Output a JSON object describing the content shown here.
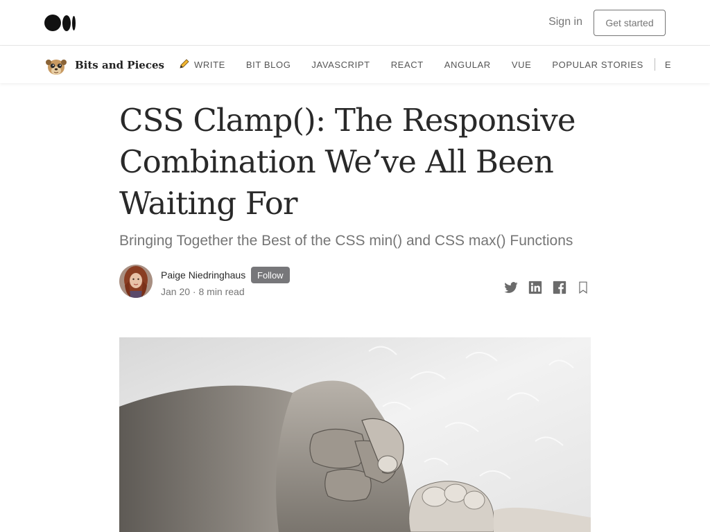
{
  "topbar": {
    "logo_icon": "medium-logo-icon",
    "sign_in_label": "Sign in",
    "get_started_label": "Get started"
  },
  "publication": {
    "name": "Bits and Pieces",
    "avatar_icon": "meerkat-avatar-icon",
    "nav": [
      {
        "label": "WRITE",
        "icon": "pencil-icon"
      },
      {
        "label": "BIT BLOG"
      },
      {
        "label": "JAVASCRIPT"
      },
      {
        "label": "REACT"
      },
      {
        "label": "ANGULAR"
      },
      {
        "label": "VUE"
      },
      {
        "label": "POPULAR STORIES"
      },
      {
        "label": "E"
      }
    ]
  },
  "article": {
    "title": "CSS Clamp(): The Responsive Combination We’ve All Been Waiting For",
    "subtitle": "Bringing Together the Best of the CSS min() and CSS max() Functions",
    "author": {
      "name": "Paige Niedringhaus",
      "follow_label": "Follow",
      "meta": "Jan 20 · 8 min read"
    },
    "share_icons": [
      "twitter-icon",
      "linkedin-icon",
      "facebook-icon",
      "bookmark-icon"
    ]
  },
  "colors": {
    "follow_bg": "#77777a",
    "muted_text": "#757575",
    "title_text": "#292929"
  }
}
